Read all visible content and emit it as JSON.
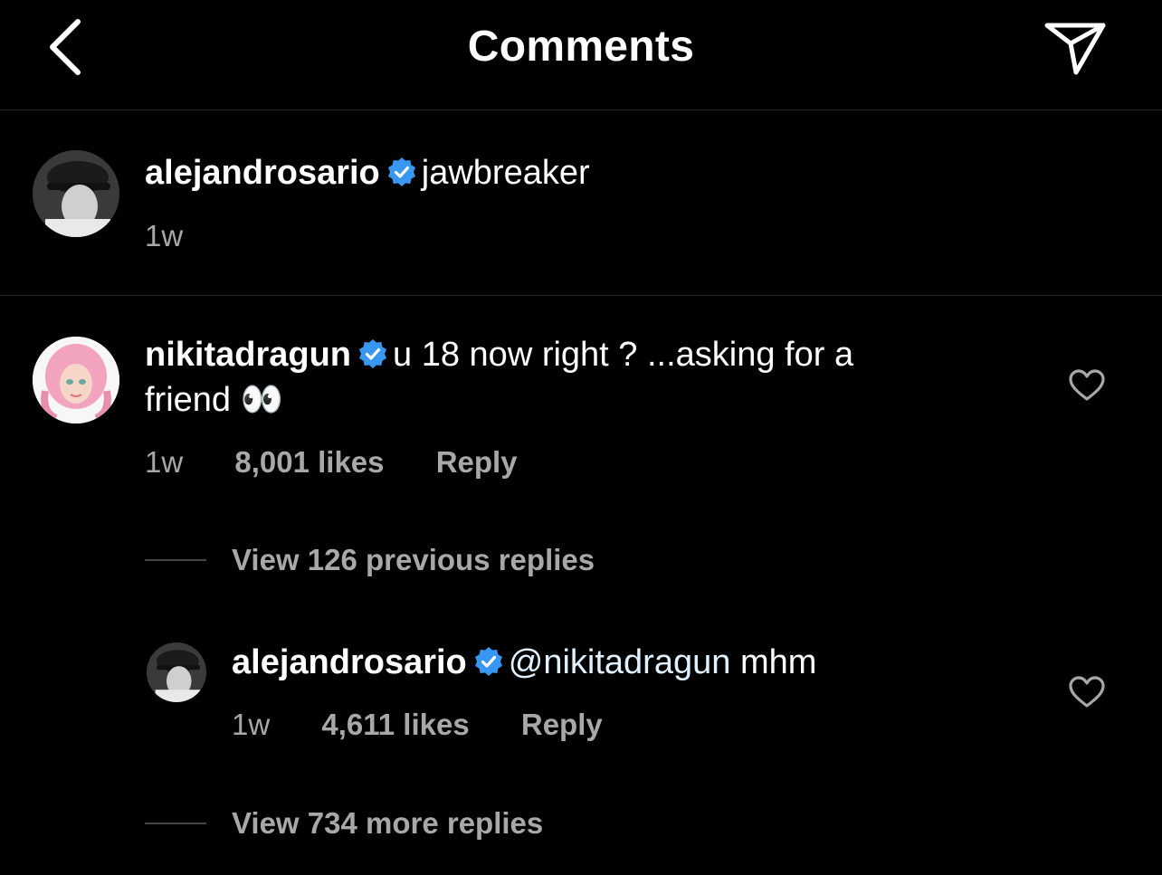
{
  "header": {
    "title": "Comments",
    "back_icon": "chevron-left-icon",
    "share_icon": "paper-plane-icon"
  },
  "caption": {
    "username": "alejandrosario",
    "text": "jawbreaker",
    "time": "1w"
  },
  "comment": {
    "username": "nikitadragun",
    "text_line1": "u 18 now right ? ...asking for a",
    "text_line2": "friend 👀",
    "time": "1w",
    "likes": "8,001 likes",
    "reply_label": "Reply",
    "view_previous": "View 126 previous replies"
  },
  "reply": {
    "username": "alejandrosario",
    "mention": "@nikitadragun",
    "text": "mhm",
    "time": "1w",
    "likes": "4,611 likes",
    "reply_label": "Reply",
    "view_more": "View 734 more replies"
  },
  "colors": {
    "background": "#000000",
    "verified": "#3897f0",
    "secondary_text": "#a8a8a8"
  }
}
